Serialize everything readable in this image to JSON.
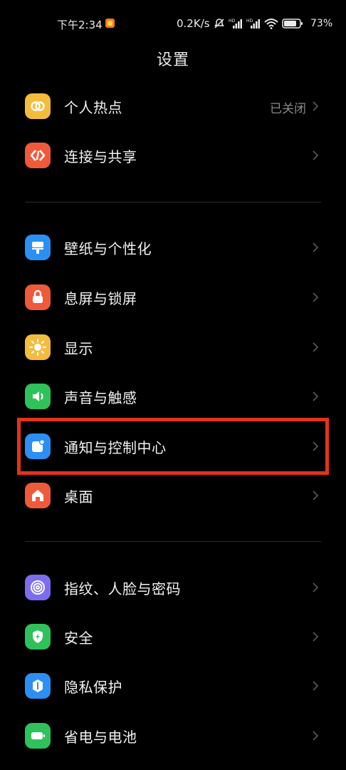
{
  "status_bar": {
    "time": "下午2:34",
    "net_speed": "0.2K/s",
    "battery": "73%"
  },
  "page": {
    "title": "设置"
  },
  "rows": [
    {
      "label": "个人热点",
      "value": "已关闭",
      "icon": "hotspot-icon",
      "color": "#f3bc3d"
    },
    {
      "label": "连接与共享",
      "icon": "connection-share-icon",
      "color": "#ef5a3b"
    },
    {
      "label": "壁纸与个性化",
      "icon": "wallpaper-icon",
      "color": "#2c8ff4"
    },
    {
      "label": "息屏与锁屏",
      "icon": "lock-icon",
      "color": "#ef5a3b"
    },
    {
      "label": "显示",
      "icon": "sun-icon",
      "color": "#f3bc3d"
    },
    {
      "label": "声音与触感",
      "icon": "speaker-icon",
      "color": "#2fc25b"
    },
    {
      "label": "通知与控制中心",
      "icon": "notification-icon",
      "color": "#2c8ff4"
    },
    {
      "label": "桌面",
      "icon": "home-icon",
      "color": "#ef5a3b"
    },
    {
      "label": "指纹、人脸与密码",
      "icon": "fingerprint-icon",
      "color": "#7c6df0"
    },
    {
      "label": "安全",
      "icon": "shield-icon",
      "color": "#2fc25b"
    },
    {
      "label": "隐私保护",
      "icon": "privacy-icon",
      "color": "#2c8ff4"
    },
    {
      "label": "省电与电池",
      "icon": "battery-icon",
      "color": "#2fc25b"
    }
  ],
  "highlight_color": "#e4321c"
}
